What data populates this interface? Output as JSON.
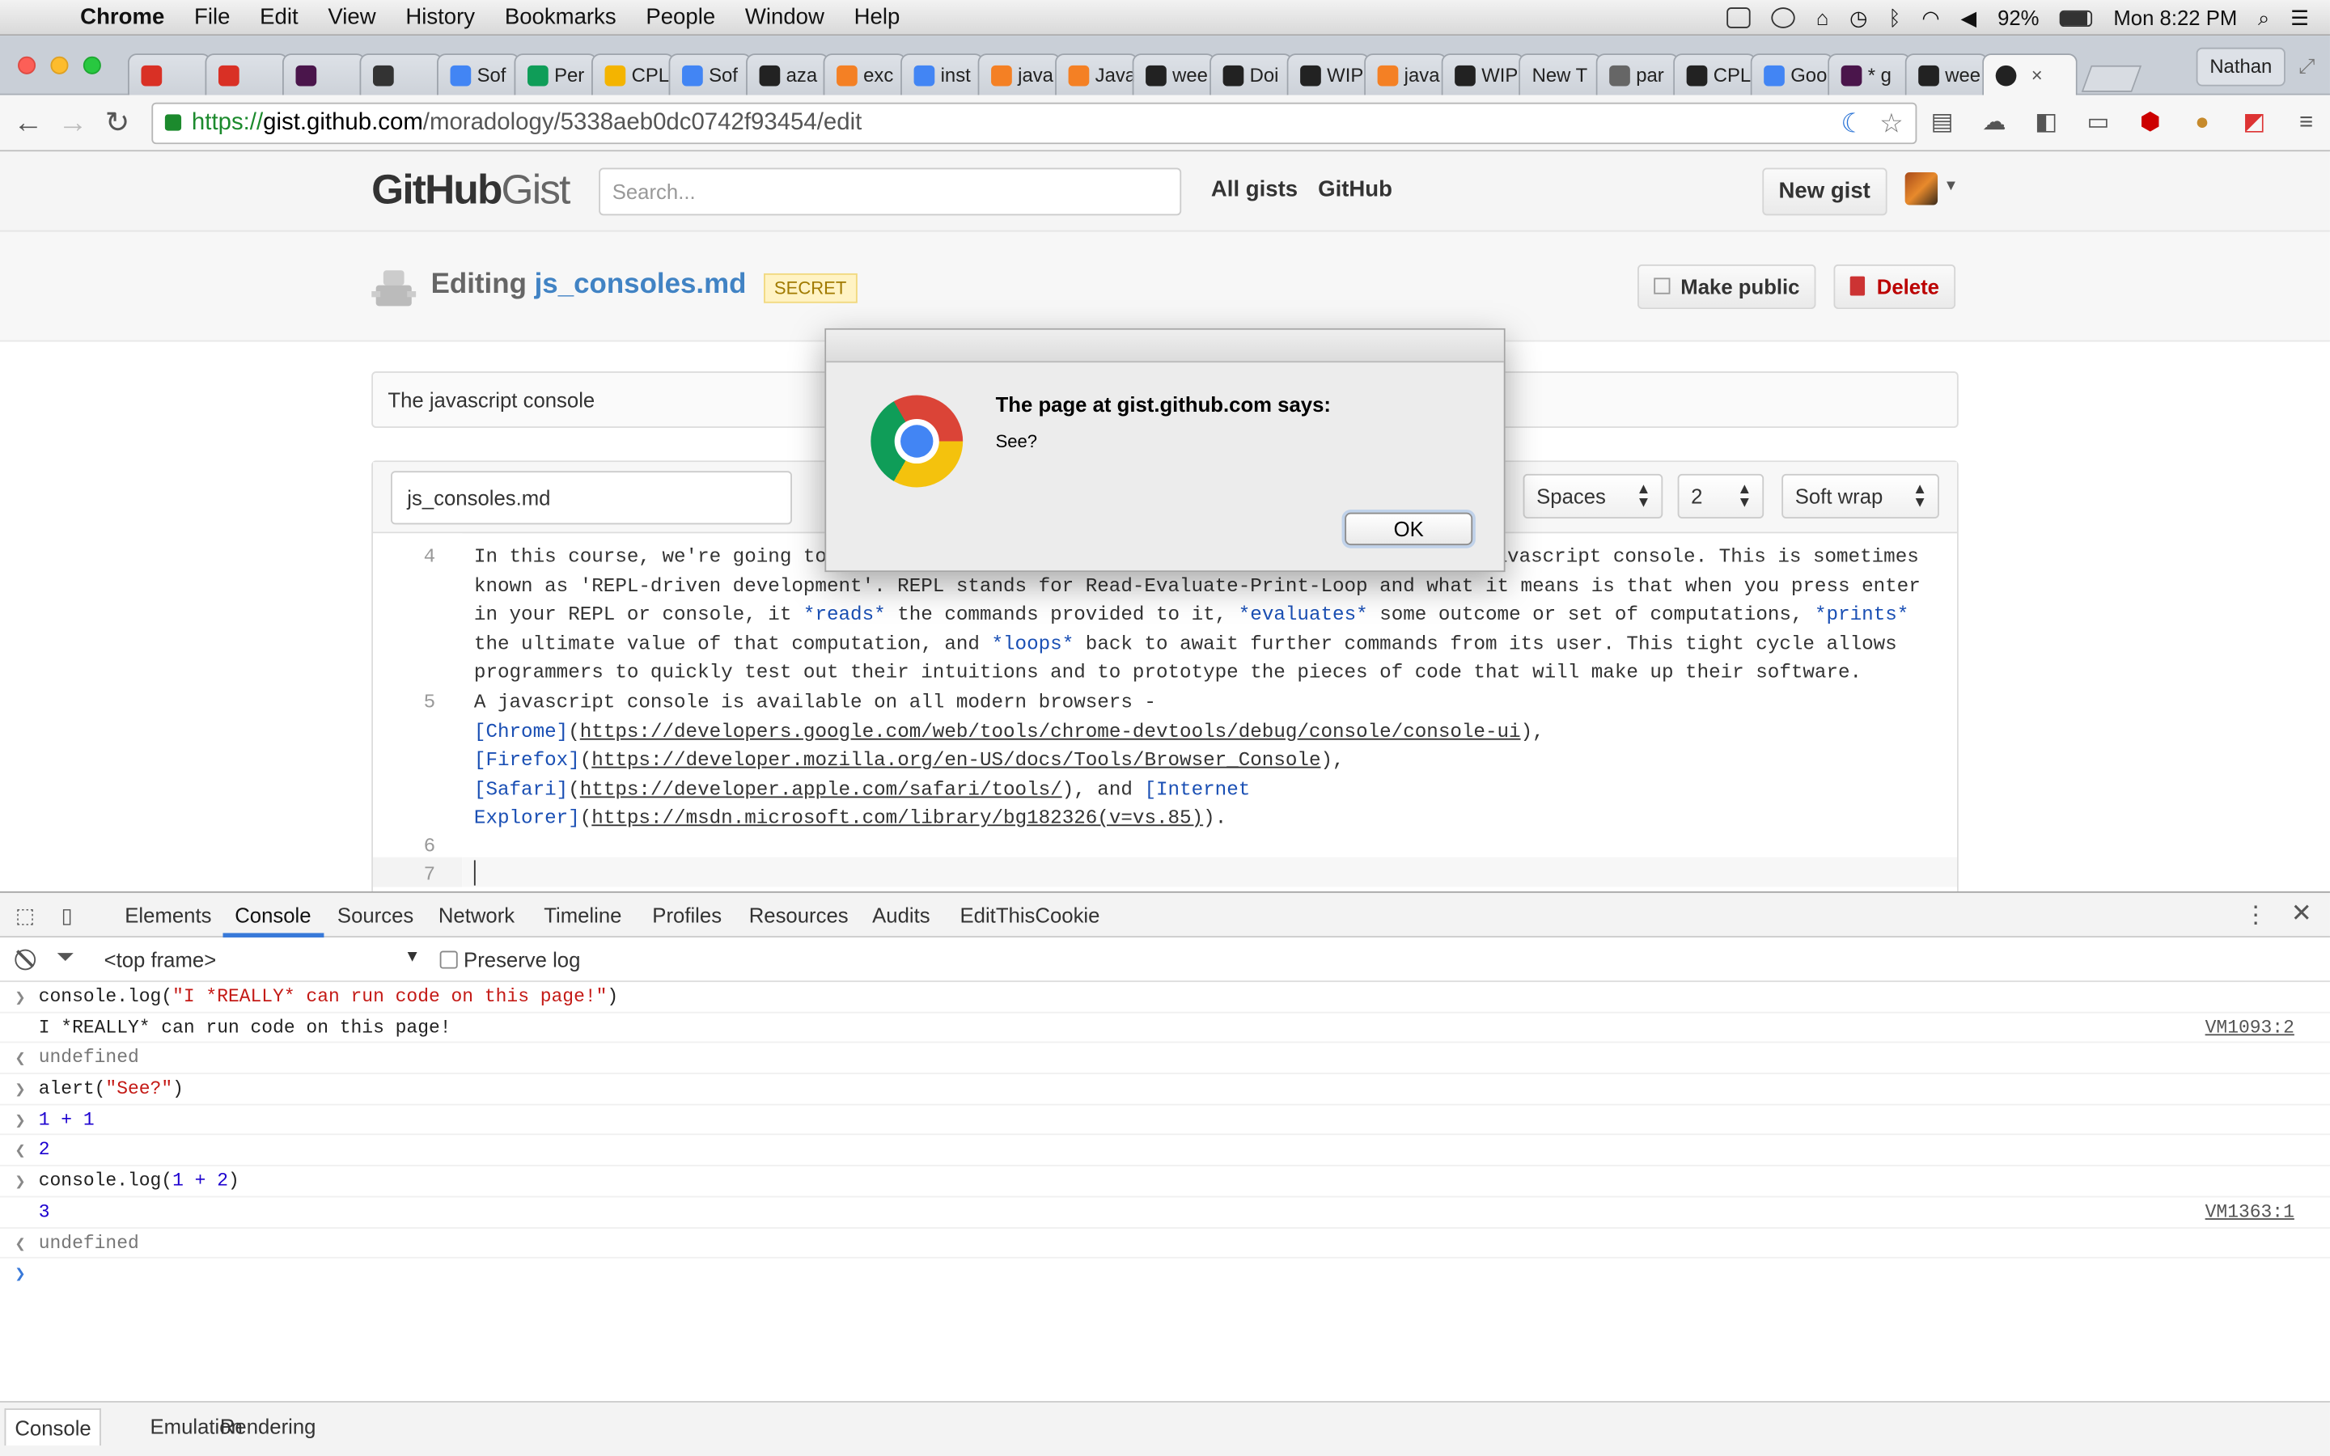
{
  "menubar": {
    "app": "Chrome",
    "items": [
      "File",
      "Edit",
      "View",
      "History",
      "Bookmarks",
      "People",
      "Window",
      "Help"
    ],
    "battery": "92%",
    "clock": "Mon 8:22 PM"
  },
  "tabs": [
    {
      "icon": "gmail-icon",
      "label": "",
      "color": "#d93025"
    },
    {
      "icon": "gmail-icon",
      "label": "",
      "color": "#d93025"
    },
    {
      "icon": "slack-icon",
      "label": "",
      "color": "#4a154b"
    },
    {
      "icon": "app-icon",
      "label": "",
      "color": "#333333"
    },
    {
      "icon": "docs-icon",
      "label": "Sof",
      "color": "#4285f4"
    },
    {
      "icon": "drive-icon",
      "label": "Per",
      "color": "#0f9d58"
    },
    {
      "icon": "slides-icon",
      "label": "CPL",
      "color": "#f4b400"
    },
    {
      "icon": "docs-icon",
      "label": "Sof",
      "color": "#4285f4"
    },
    {
      "icon": "github-icon",
      "label": "aza",
      "color": "#222222"
    },
    {
      "icon": "stackoverflow-icon",
      "label": "exc",
      "color": "#f48024"
    },
    {
      "icon": "google-icon",
      "label": "inst",
      "color": "#4285f4"
    },
    {
      "icon": "stackoverflow-icon",
      "label": "java",
      "color": "#f48024"
    },
    {
      "icon": "stackoverflow-icon",
      "label": "Java",
      "color": "#f48024"
    },
    {
      "icon": "github-icon",
      "label": "wee",
      "color": "#222222"
    },
    {
      "icon": "github-icon",
      "label": "Doi",
      "color": "#222222"
    },
    {
      "icon": "github-icon",
      "label": "WIP",
      "color": "#222222"
    },
    {
      "icon": "stackoverflow-icon",
      "label": "java",
      "color": "#f48024"
    },
    {
      "icon": "github-icon",
      "label": "WIP",
      "color": "#222222"
    },
    {
      "icon": "none",
      "label": "New T",
      "color": ""
    },
    {
      "icon": "file-icon",
      "label": "par",
      "color": "#666666"
    },
    {
      "icon": "github-icon",
      "label": "CPL",
      "color": "#222222"
    },
    {
      "icon": "google-icon",
      "label": "Goo",
      "color": "#4285f4"
    },
    {
      "icon": "slack-icon",
      "label": "* g",
      "color": "#4a154b"
    },
    {
      "icon": "github-icon",
      "label": "wee",
      "color": "#222222"
    }
  ],
  "active_tab": {
    "icon": "github-icon",
    "close": "×"
  },
  "profile": "Nathan",
  "address": {
    "scheme": "https://",
    "host": "gist.github.com",
    "path": "/moradology/5338aeb0dc0742f93454/edit"
  },
  "gist": {
    "logo_main": "GitHub",
    "logo_sub": "Gist",
    "search_placeholder": "Search...",
    "nav": [
      "All gists",
      "GitHub"
    ],
    "new_gist": "New gist",
    "editing_prefix": "Editing",
    "filename_title": "js_consoles.md",
    "secret_badge": "SECRET",
    "make_public": "Make public",
    "delete": "Delete",
    "description": "The javascript console",
    "filename_input": "js_consoles.md",
    "indent_mode": "Spaces",
    "indent_size": "2",
    "wrap_mode": "Soft wrap"
  },
  "editor_lines": {
    "n4": "4",
    "n5": "5",
    "n6": "6",
    "n7": "7",
    "l4a_pre": "In this course, we're going to",
    "l4a_post": "avascript console. This is sometimes",
    "l4b": "known as 'REPL-driven development'. REPL stands for Read-Evaluate-Print-Loop and what it means is that when you press enter",
    "l4c_1": "in your REPL or console, it ",
    "l4c_e1": "*reads*",
    "l4c_2": " the commands provided to it, ",
    "l4c_e2": "*evaluates*",
    "l4c_3": " some outcome or set of computations, ",
    "l4c_e3": "*prints*",
    "l4d_1": "the ultimate value of that computation, and ",
    "l4d_e1": "*loops*",
    "l4d_2": " back to await further commands from its user. This tight cycle allows",
    "l4e": "programmers to quickly test out their intuitions and to prototype the pieces of code that will make up their software.",
    "l5a": "A javascript console is available on all modern browsers -",
    "l5b_l": "[Chrome]",
    "l5b_u": "https://developers.google.com/web/tools/chrome-devtools/debug/console/console-ui",
    "l5c_l": "[Firefox]",
    "l5c_u": "https://developer.mozilla.org/en-US/docs/Tools/Browser_Console",
    "l5d_l": "[Safari]",
    "l5d_u": "https://developer.apple.com/safari/tools/",
    "l5d_m": "), and ",
    "l5d_l2": "[Internet",
    "l5e_l": "Explorer]",
    "l5e_u": "https://msdn.microsoft.com/library/bg182326(v=vs.85)"
  },
  "alert": {
    "title": "The page at gist.github.com says:",
    "message": "See?",
    "ok": "OK"
  },
  "devtools": {
    "tabs": [
      "Elements",
      "Console",
      "Sources",
      "Network",
      "Timeline",
      "Profiles",
      "Resources",
      "Audits",
      "EditThisCookie"
    ],
    "active_tab": "Console",
    "frame": "<top frame>",
    "preserve_log": "Preserve log",
    "console": [
      {
        "type": "input",
        "pre": "console.log(",
        "str": "\"I *REALLY* can run code on this page!\"",
        "post": ")"
      },
      {
        "type": "log",
        "text": "I *REALLY* can run code on this page!",
        "source": "VM1093:2"
      },
      {
        "type": "result",
        "text": "undefined"
      },
      {
        "type": "input",
        "pre": "alert(",
        "str": "\"See?\"",
        "post": ")"
      },
      {
        "type": "input-num",
        "text": "1 + 1"
      },
      {
        "type": "result-num",
        "text": "2"
      },
      {
        "type": "input",
        "pre": "console.log(",
        "num": "1 + 2",
        "post": ")"
      },
      {
        "type": "log-num",
        "text": "3",
        "source": "VM1363:1"
      },
      {
        "type": "result",
        "text": "undefined"
      }
    ],
    "drawer_tabs": [
      "Console",
      "Emulation",
      "Rendering"
    ]
  }
}
